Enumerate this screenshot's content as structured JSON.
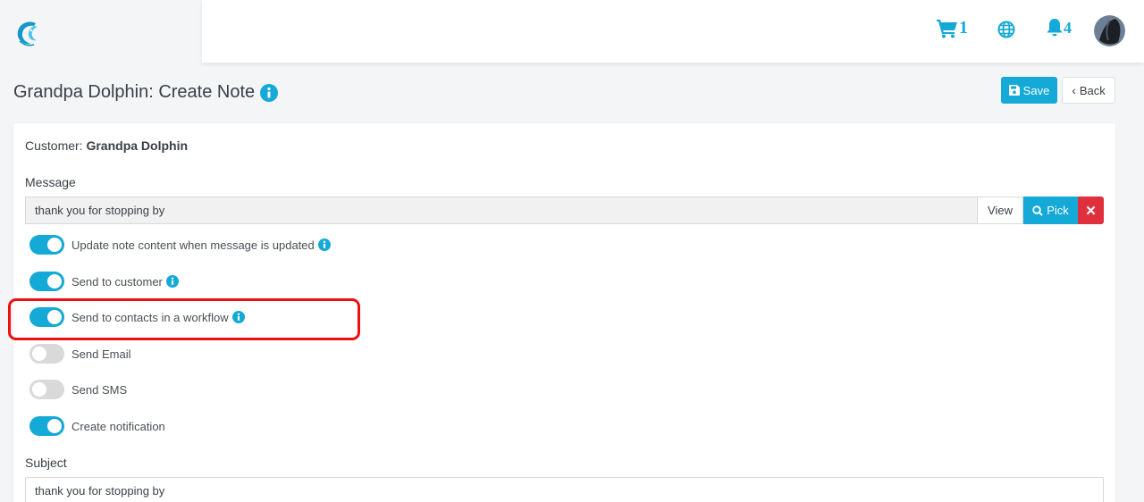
{
  "header": {
    "logo_icon": "dolphin-logo-icon",
    "cart_count": "1",
    "notification_count": "4",
    "accent_color": "#14a9d6"
  },
  "page": {
    "title": "Grandpa Dolphin: Create Note",
    "save_label": "Save",
    "back_label": "Back"
  },
  "form": {
    "customer_label": "Customer:",
    "customer_name": "Grandpa Dolphin",
    "message_label": "Message",
    "message_value": "thank you for stopping by",
    "view_label": "View",
    "pick_label": "Pick",
    "toggles": [
      {
        "label": "Update note content when message is updated",
        "on": true,
        "info": true
      },
      {
        "label": "Send to customer",
        "on": true,
        "info": true
      },
      {
        "label": "Send to contacts in a workflow",
        "on": true,
        "info": true,
        "highlighted": true
      },
      {
        "label": "Send Email",
        "on": false,
        "info": false
      },
      {
        "label": "Send SMS",
        "on": false,
        "info": false
      },
      {
        "label": "Create notification",
        "on": true,
        "info": false
      }
    ],
    "subject_label": "Subject",
    "subject_value": "thank you for stopping by"
  },
  "colors": {
    "primary": "#14a9d6",
    "danger": "#e0303d",
    "highlight": "#ee1010"
  }
}
